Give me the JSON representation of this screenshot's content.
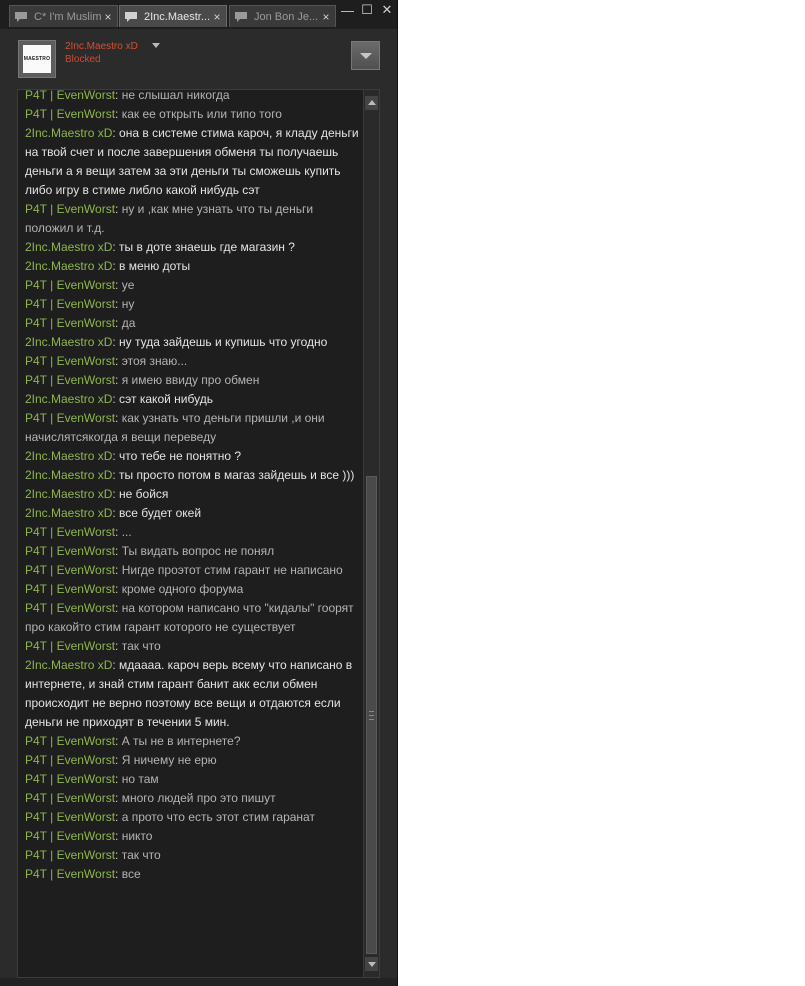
{
  "tabs": [
    {
      "label": "C* I'm Muslim",
      "close": "×",
      "active": false
    },
    {
      "label": "2Inc.Maestr...",
      "close": "×",
      "active": true
    },
    {
      "label": "Jon Bon Je...",
      "close": "×",
      "active": false
    }
  ],
  "window_controls": {
    "minimize": "—",
    "maximize": "☐",
    "close": "✕"
  },
  "header": {
    "avatar_text": "MAESTRO",
    "friend_name": "2Inc.Maestro xD",
    "friend_status": "Blocked"
  },
  "colors": {
    "sender_name": "#8fb64c",
    "status_blocked": "#cc4a34",
    "background": "#2b2b2b"
  },
  "icons": {
    "tab_bubble": "chat-bubble-icon",
    "menu": "chevron-down-icon"
  },
  "messages": [
    {
      "sender": "P4T | EvenWorst",
      "text": "не слышал никогда",
      "self": false
    },
    {
      "sender": "P4T | EvenWorst",
      "text": "как ее открыть или типо того",
      "self": false
    },
    {
      "sender": "2Inc.Maestro xD",
      "text": "она в системе стима кароч, я кладу деньги на твой счет и после завершения обменя ты получаешь деньги а я вещи затем за эти деньги ты сможешь купить либо игру в стиме либло какой нибудь сэт",
      "self": true
    },
    {
      "sender": "P4T | EvenWorst",
      "text": "ну и ,как мне узнать что ты деньги положил и т.д.",
      "self": false
    },
    {
      "sender": "2Inc.Maestro xD",
      "text": "ты в доте знаешь где магазин ?",
      "self": true
    },
    {
      "sender": "2Inc.Maestro xD",
      "text": "в меню доты",
      "self": true
    },
    {
      "sender": "P4T | EvenWorst",
      "text": "ye",
      "self": false
    },
    {
      "sender": "P4T | EvenWorst",
      "text": "ну",
      "self": false
    },
    {
      "sender": "P4T | EvenWorst",
      "text": "да",
      "self": false
    },
    {
      "sender": "2Inc.Maestro xD",
      "text": "ну туда зайдешь и купишь что угодно",
      "self": true
    },
    {
      "sender": "P4T | EvenWorst",
      "text": "этоя знаю...",
      "self": false
    },
    {
      "sender": "P4T | EvenWorst",
      "text": "я имею ввиду про обмен",
      "self": false
    },
    {
      "sender": "2Inc.Maestro xD",
      "text": "сэт какой нибудь",
      "self": true
    },
    {
      "sender": "P4T | EvenWorst",
      "text": "как узнать что деньги пришли ,и они начислятсякогда я вещи переведу",
      "self": false
    },
    {
      "sender": "2Inc.Maestro xD",
      "text": "что тебе не понятно ?",
      "self": true
    },
    {
      "sender": "2Inc.Maestro xD",
      "text": "ты просто потом в магаз зайдешь и все )))",
      "self": true
    },
    {
      "sender": "2Inc.Maestro xD",
      "text": "не бойся",
      "self": true
    },
    {
      "sender": "2Inc.Maestro xD",
      "text": "все будет окей",
      "self": true
    },
    {
      "sender": "P4T | EvenWorst",
      "text": "...",
      "self": false
    },
    {
      "sender": "P4T | EvenWorst",
      "text": "Ты видать вопрос не понял",
      "self": false
    },
    {
      "sender": "P4T | EvenWorst",
      "text": "Нигде проэтот стим гарант не написано",
      "self": false
    },
    {
      "sender": "P4T | EvenWorst",
      "text": "кроме одного форума",
      "self": false
    },
    {
      "sender": "P4T | EvenWorst",
      "text": "на котором написано что \"кидалы\" гоорят про какойто стим гарант которого не существует",
      "self": false
    },
    {
      "sender": "P4T | EvenWorst",
      "text": "так что",
      "self": false
    },
    {
      "sender": "2Inc.Maestro xD",
      "text": "мдаааа. кароч верь всему что написано в интернете, и знай стим гарант банит акк если обмен происходит не верно поэтому все вещи и отдаются если деньги не приходят в течении 5 мин.",
      "self": true
    },
    {
      "sender": "P4T | EvenWorst",
      "text": "А ты не в интернете?",
      "self": false
    },
    {
      "sender": "P4T | EvenWorst",
      "text": "Я ничему не ерю",
      "self": false
    },
    {
      "sender": "P4T | EvenWorst",
      "text": "но там",
      "self": false
    },
    {
      "sender": "P4T | EvenWorst",
      "text": "много людей про это пишут",
      "self": false
    },
    {
      "sender": "P4T | EvenWorst",
      "text": "а прото что есть этот стим гаранат",
      "self": false
    },
    {
      "sender": "P4T | EvenWorst",
      "text": "никто",
      "self": false
    },
    {
      "sender": "P4T | EvenWorst",
      "text": "так что",
      "self": false
    },
    {
      "sender": "P4T | EvenWorst",
      "text": "все",
      "self": false
    }
  ]
}
